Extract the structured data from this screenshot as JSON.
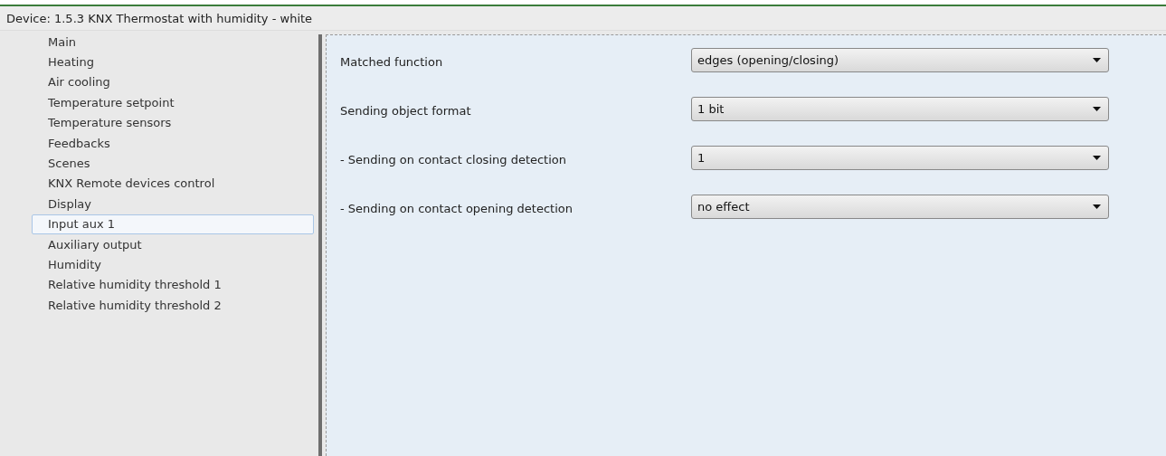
{
  "window": {
    "title": "Device: 1.5.3  KNX Thermostat with humidity - white"
  },
  "sidebar": {
    "items": [
      {
        "label": "Main",
        "selected": false
      },
      {
        "label": "Heating",
        "selected": false
      },
      {
        "label": "Air cooling",
        "selected": false
      },
      {
        "label": "Temperature setpoint",
        "selected": false
      },
      {
        "label": "Temperature sensors",
        "selected": false
      },
      {
        "label": "Feedbacks",
        "selected": false
      },
      {
        "label": "Scenes",
        "selected": false
      },
      {
        "label": "KNX Remote devices control",
        "selected": false
      },
      {
        "label": "Display",
        "selected": false
      },
      {
        "label": "Input aux 1",
        "selected": true
      },
      {
        "label": "Auxiliary output",
        "selected": false
      },
      {
        "label": "Humidity",
        "selected": false
      },
      {
        "label": "Relative humidity threshold 1",
        "selected": false
      },
      {
        "label": "Relative humidity threshold 2",
        "selected": false
      }
    ]
  },
  "parameters": [
    {
      "label": "Matched function",
      "value": "edges (opening/closing)"
    },
    {
      "label": "Sending object format",
      "value": "1 bit"
    },
    {
      "label": "- Sending on contact closing detection",
      "value": "1"
    },
    {
      "label": "- Sending on contact opening detection",
      "value": "no effect"
    }
  ]
}
